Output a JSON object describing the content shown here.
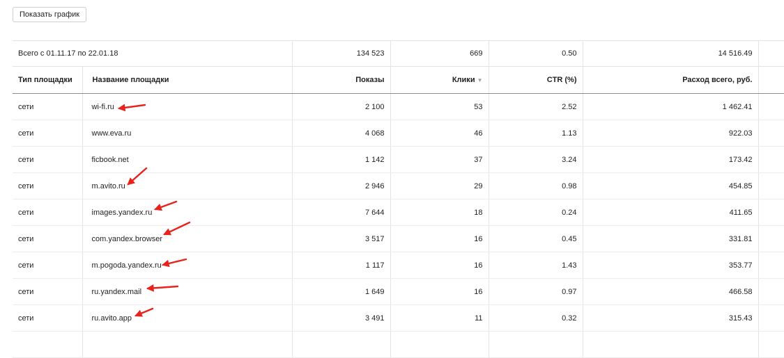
{
  "toolbar": {
    "show_chart_label": "Показать график"
  },
  "totals": {
    "label": "Всего с 01.11.17 по 22.01.18",
    "impressions": "134 523",
    "clicks": "669",
    "ctr": "0.50",
    "cost": "14 516.49"
  },
  "columns": {
    "type": "Тип площадки",
    "name": "Название площадки",
    "impressions": "Показы",
    "clicks": "Клики",
    "ctr": "CTR (%)",
    "cost": "Расход всего, руб."
  },
  "sort_indicator": "▼",
  "rows": [
    {
      "type": "сети",
      "name": "wi-fi.ru",
      "impressions": "2 100",
      "clicks": "53",
      "ctr": "2.52",
      "cost": "1 462.41"
    },
    {
      "type": "сети",
      "name": "www.eva.ru",
      "impressions": "4 068",
      "clicks": "46",
      "ctr": "1.13",
      "cost": "922.03"
    },
    {
      "type": "сети",
      "name": "ficbook.net",
      "impressions": "1 142",
      "clicks": "37",
      "ctr": "3.24",
      "cost": "173.42"
    },
    {
      "type": "сети",
      "name": "m.avito.ru",
      "impressions": "2 946",
      "clicks": "29",
      "ctr": "0.98",
      "cost": "454.85"
    },
    {
      "type": "сети",
      "name": "images.yandex.ru",
      "impressions": "7 644",
      "clicks": "18",
      "ctr": "0.24",
      "cost": "411.65"
    },
    {
      "type": "сети",
      "name": "com.yandex.browser",
      "impressions": "3 517",
      "clicks": "16",
      "ctr": "0.45",
      "cost": "331.81"
    },
    {
      "type": "сети",
      "name": "m.pogoda.yandex.ru",
      "impressions": "1 117",
      "clicks": "16",
      "ctr": "1.43",
      "cost": "353.77"
    },
    {
      "type": "сети",
      "name": "ru.yandex.mail",
      "impressions": "1 649",
      "clicks": "16",
      "ctr": "0.97",
      "cost": "466.58"
    },
    {
      "type": "сети",
      "name": "ru.avito.app",
      "impressions": "3 491",
      "clicks": "11",
      "ctr": "0.32",
      "cost": "315.43"
    },
    {
      "type": "",
      "name": "",
      "impressions": "",
      "clicks": "",
      "ctr": "",
      "cost": ""
    }
  ],
  "annotation_color": "#e8231c"
}
